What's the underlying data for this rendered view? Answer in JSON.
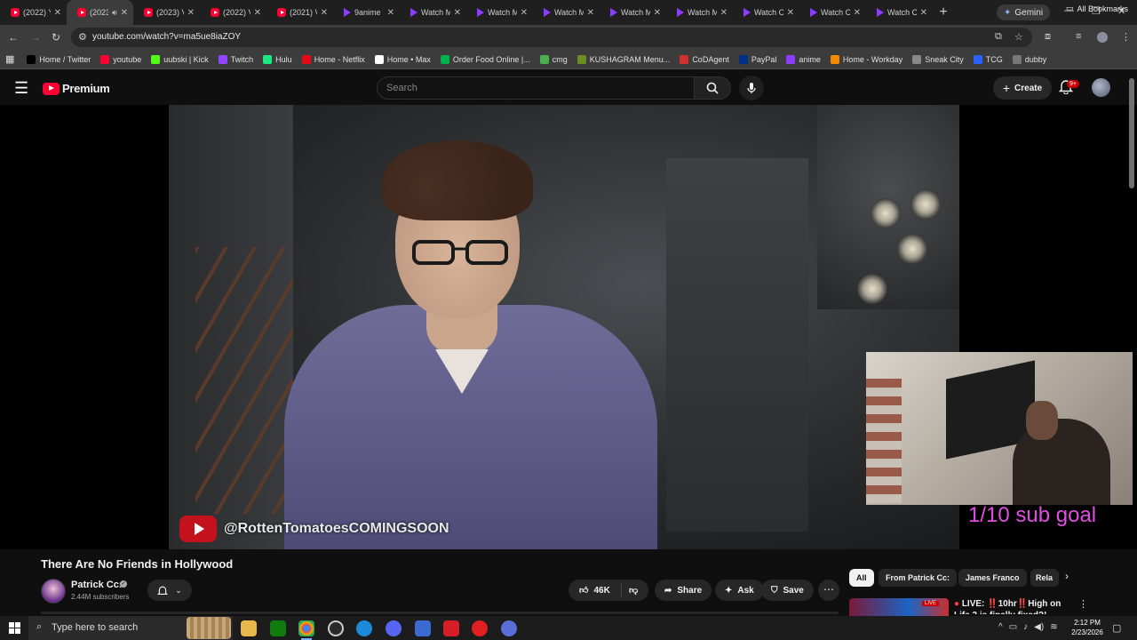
{
  "browser": {
    "tabs": [
      {
        "label": "(2022) Y",
        "icon": "youtube-icon",
        "active": false
      },
      {
        "label": "(2023)",
        "icon": "youtube-icon",
        "active": true
      },
      {
        "label": "(2023) V",
        "icon": "youtube-icon",
        "active": false
      },
      {
        "label": "(2022) V",
        "icon": "youtube-icon",
        "active": false
      },
      {
        "label": "(2021) V",
        "icon": "youtube-icon",
        "active": false
      },
      {
        "label": "9anime",
        "icon": "play-icon",
        "active": false
      },
      {
        "label": "Watch M",
        "icon": "play-icon",
        "active": false
      },
      {
        "label": "Watch M",
        "icon": "play-icon",
        "active": false
      },
      {
        "label": "Watch M",
        "icon": "play-icon",
        "active": false
      },
      {
        "label": "Watch M",
        "icon": "play-icon",
        "active": false
      },
      {
        "label": "Watch M",
        "icon": "play-icon",
        "active": false
      },
      {
        "label": "Watch C",
        "icon": "play-icon",
        "active": false
      },
      {
        "label": "Watch C",
        "icon": "play-icon",
        "active": false
      },
      {
        "label": "Watch C",
        "icon": "play-icon",
        "active": false
      }
    ],
    "gemini_label": "Gemini",
    "url": "youtube.com/watch?v=ma5ue8iaZOY",
    "bookmarks": [
      {
        "label": "Home / Twitter",
        "color": "#000000"
      },
      {
        "label": "youtube",
        "color": "#ff0033"
      },
      {
        "label": "uubski | Kick",
        "color": "#53fc18"
      },
      {
        "label": "Twitch",
        "color": "#9146ff"
      },
      {
        "label": "Hulu",
        "color": "#1ce783"
      },
      {
        "label": "Home - Netflix",
        "color": "#e50914"
      },
      {
        "label": "Home • Max",
        "color": "#ffffff"
      },
      {
        "label": "Order Food Online |...",
        "color": "#00b14f"
      },
      {
        "label": "cmg",
        "color": "#4caf50"
      },
      {
        "label": "KUSHAGRAM Menu...",
        "color": "#6b8e23"
      },
      {
        "label": "CoDAgent",
        "color": "#d32f2f"
      },
      {
        "label": "PayPal",
        "color": "#003087"
      },
      {
        "label": "anime",
        "color": "#8c3cff"
      },
      {
        "label": "Home - Workday",
        "color": "#f38b00"
      },
      {
        "label": "Sneak City",
        "color": "#888888"
      },
      {
        "label": "TCG",
        "color": "#2962ff"
      },
      {
        "label": "dubby",
        "color": "#777777"
      }
    ],
    "all_bookmarks_label": "All Bookmarks"
  },
  "youtube": {
    "logo_text": "Premium",
    "search_placeholder": "Search",
    "create_label": "Create",
    "notification_count": "9+",
    "video": {
      "watermark": "@RottenTomatoesCOMINGSOON",
      "overlay_text": "1/10 sub goal"
    },
    "title": "There Are No Friends in Hollywood",
    "channel": {
      "name": "Patrick Cc:",
      "subscribers": "2.44M subscribers"
    },
    "actions": {
      "likes": "46K",
      "share": "Share",
      "ask": "Ask",
      "save": "Save"
    },
    "chips": [
      "All",
      "From Patrick Cc:",
      "James Franco",
      "Rela"
    ],
    "recommendation": {
      "live_badge": "LIVE",
      "title": "LIVE: ‼️10hr‼️High on Life 2 is finally fixed?!"
    }
  },
  "taskbar": {
    "search_placeholder": "Type here to search",
    "time": "2:12 PM",
    "date": "2/23/2026"
  },
  "colors": {
    "youtube_red": "#ff0033",
    "subgoal": "#e04de0",
    "background": "#0f0f0f"
  }
}
